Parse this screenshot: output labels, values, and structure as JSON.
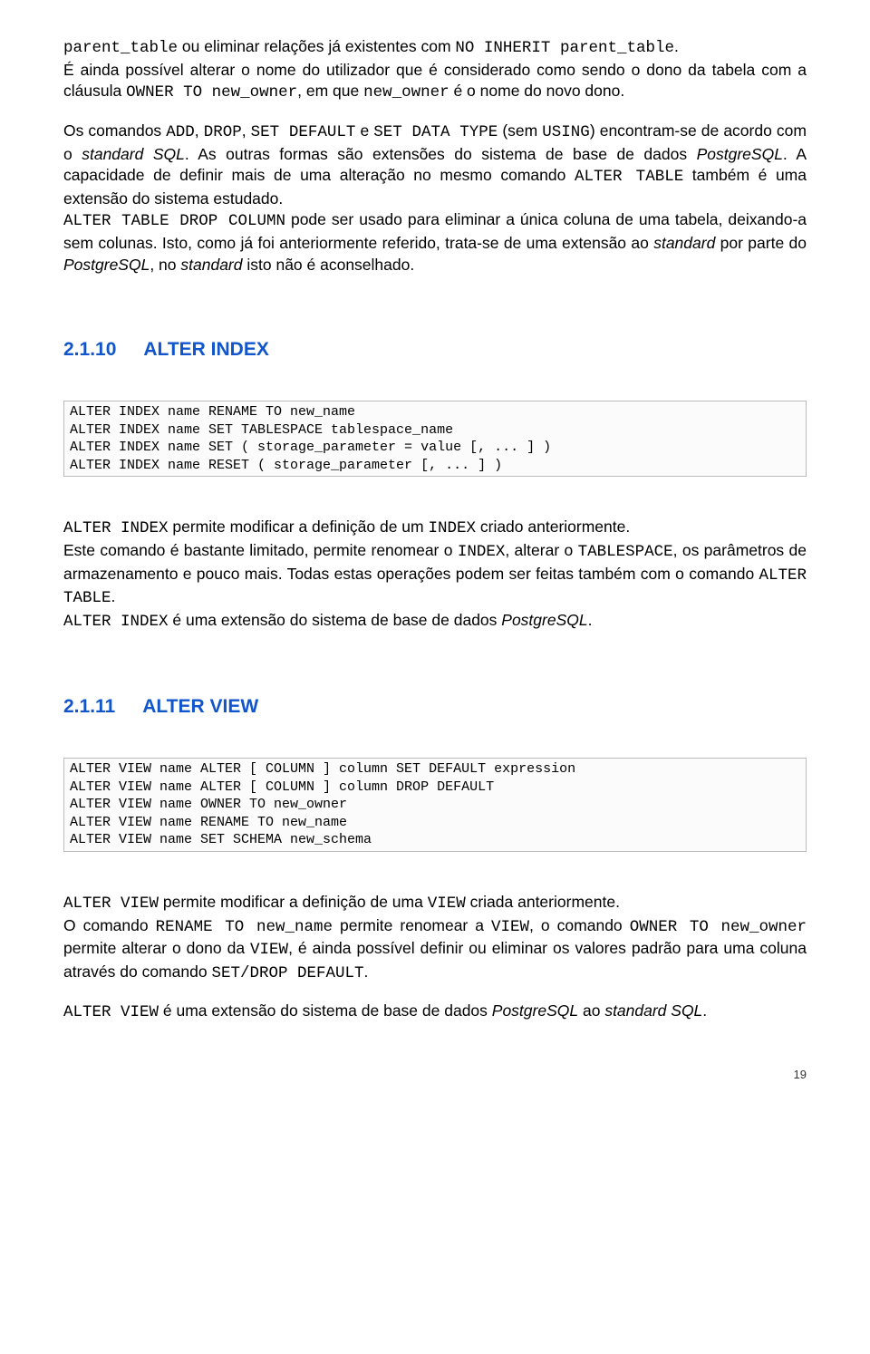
{
  "para1": {
    "run1_mono": "parent_table",
    "run2": " ou eliminar relações já existentes com ",
    "run3_mono": "NO INHERIT parent_table",
    "run4": "."
  },
  "para2": {
    "run1": "É ainda possível alterar o nome do utilizador que é considerado como sendo o dono da tabela com a cláusula ",
    "run2_mono": "OWNER TO new_owner",
    "run3": ", em que ",
    "run4_mono": "new_owner",
    "run5": " é o nome do novo dono."
  },
  "para3": {
    "run1": "Os comandos ",
    "run2_mono": "ADD",
    "run3": ", ",
    "run4_mono": "DROP",
    "run5": ", ",
    "run6_mono": "SET DEFAULT",
    "run7": " e ",
    "run8_mono": "SET DATA TYPE",
    "run9": " (sem ",
    "run10_mono": "USING",
    "run11": ") encontram-se de acordo com o ",
    "run12_ital": "standard SQL",
    "run13": ". As outras formas são extensões do sistema de base de dados ",
    "run14_ital": "PostgreSQL",
    "run15": ". A capacidade de definir mais de uma alteração no mesmo comando ",
    "run16_mono": "ALTER TABLE",
    "run17": " também é uma extensão do sistema estudado."
  },
  "para4": {
    "run1_mono": "ALTER TABLE DROP COLUMN",
    "run2": " pode ser usado para eliminar a única coluna de uma tabela, deixando-a sem colunas. Isto, como já foi anteriormente referido, trata-se de uma extensão ao ",
    "run3_ital": "standard",
    "run4": " por parte do ",
    "run5_ital": "PostgreSQL",
    "run6": ", no ",
    "run7_ital": "standard",
    "run8": " isto não é aconselhado."
  },
  "section1": {
    "num": "2.1.10",
    "title": "ALTER INDEX"
  },
  "code1": "ALTER INDEX name RENAME TO new_name\nALTER INDEX name SET TABLESPACE tablespace_name\nALTER INDEX name SET ( storage_parameter = value [, ... ] )\nALTER INDEX name RESET ( storage_parameter [, ... ] )",
  "para5": {
    "run1_mono": "ALTER INDEX",
    "run2": " permite modificar a definição de um ",
    "run3_mono": "INDEX",
    "run4": " criado anteriormente."
  },
  "para6": {
    "run1": "Este comando é bastante limitado, permite renomear o ",
    "run2_mono": "INDEX",
    "run3": ", alterar o ",
    "run4_mono": "TABLESPACE",
    "run5": ", os parâmetros de armazenamento e pouco mais. Todas estas operações podem ser feitas também com o comando ",
    "run6_mono": "ALTER TABLE",
    "run7": "."
  },
  "para7": {
    "run1_mono": "ALTER INDEX",
    "run2": " é uma extensão do sistema de base de dados ",
    "run3_ital": "PostgreSQL",
    "run4": "."
  },
  "section2": {
    "num": "2.1.11",
    "title": "ALTER VIEW"
  },
  "code2": "ALTER VIEW name ALTER [ COLUMN ] column SET DEFAULT expression\nALTER VIEW name ALTER [ COLUMN ] column DROP DEFAULT\nALTER VIEW name OWNER TO new_owner\nALTER VIEW name RENAME TO new_name\nALTER VIEW name SET SCHEMA new_schema",
  "para8": {
    "run1_mono": "ALTER VIEW",
    "run2": " permite modificar a definição de uma ",
    "run3_mono": "VIEW",
    "run4": " criada anteriormente."
  },
  "para9": {
    "run1": "O comando ",
    "run2_mono": "RENAME TO new_name",
    "run3": " permite renomear a ",
    "run4_mono": "VIEW",
    "run5": ", o comando ",
    "run6_mono": "OWNER TO new_owner",
    "run7": " permite alterar o dono da ",
    "run8_mono": "VIEW",
    "run9": ", é ainda possível definir ou eliminar os valores padrão para uma coluna através do comando ",
    "run10_mono": "SET/DROP DEFAULT",
    "run11": "."
  },
  "para10": {
    "run1_mono": "ALTER VIEW",
    "run2": " é uma extensão do sistema de base de dados ",
    "run3_ital": "PostgreSQL",
    "run4": " ao ",
    "run5_ital": "standard SQL",
    "run6": "."
  },
  "pagenum": "19"
}
